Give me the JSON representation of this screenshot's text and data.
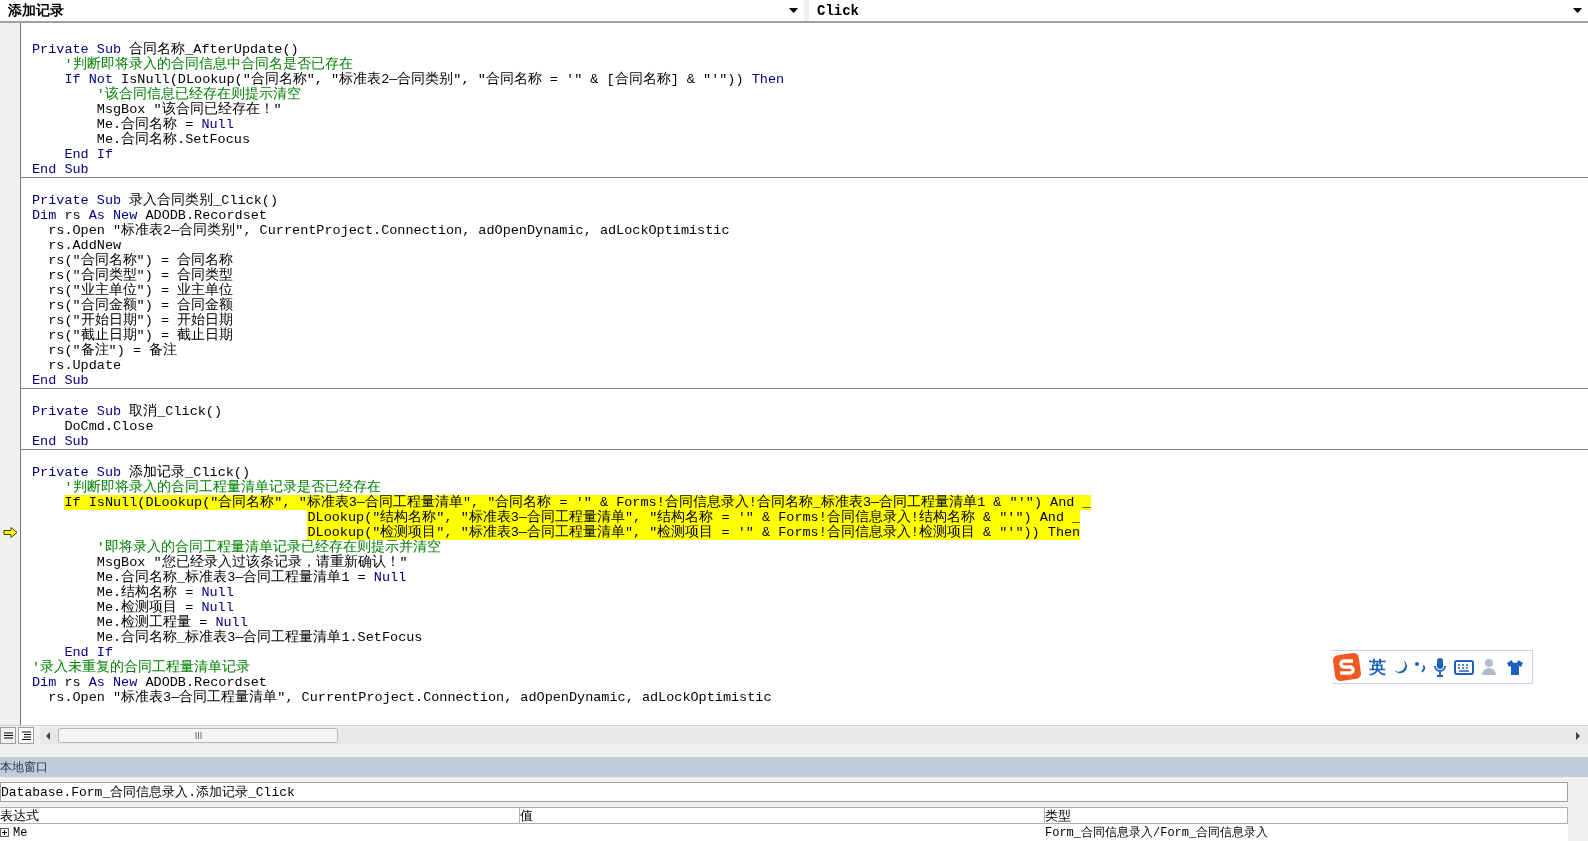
{
  "header": {
    "object_dropdown": "添加记录",
    "procedure_dropdown": "Click"
  },
  "procedures": [
    {
      "lines": [
        {
          "parts": [
            {
              "kind": "keyword",
              "text": "Private Sub"
            },
            {
              "kind": "plain",
              "text": " 合同名称_AfterUpdate()"
            }
          ]
        },
        {
          "parts": [
            {
              "kind": "comment",
              "text": "    '判断即将录入的合同信息中合同名是否已存在"
            }
          ]
        },
        {
          "parts": [
            {
              "kind": "keyword",
              "text": "    If Not"
            },
            {
              "kind": "plain",
              "text": " IsNull(DLookup(\"合同名称\", \"标准表2—合同类别\", \"合同名称 = '\" & [合同名称] & \"'\")) "
            },
            {
              "kind": "keyword",
              "text": "Then"
            }
          ]
        },
        {
          "parts": [
            {
              "kind": "comment",
              "text": "        '该合同信息已经存在则提示清空"
            }
          ]
        },
        {
          "parts": [
            {
              "kind": "plain",
              "text": "        MsgBox \"该合同已经存在！\""
            }
          ]
        },
        {
          "parts": [
            {
              "kind": "plain",
              "text": "        Me.合同名称 = "
            },
            {
              "kind": "keyword",
              "text": "Null"
            }
          ]
        },
        {
          "parts": [
            {
              "kind": "plain",
              "text": "        Me.合同名称.SetFocus"
            }
          ]
        },
        {
          "parts": [
            {
              "kind": "keyword",
              "text": "    End If"
            }
          ]
        },
        {
          "parts": [
            {
              "kind": "keyword",
              "text": "End Sub"
            }
          ]
        }
      ]
    },
    {
      "lines": [
        {
          "parts": [
            {
              "kind": "keyword",
              "text": "Private Sub"
            },
            {
              "kind": "plain",
              "text": " 录入合同类别_Click()"
            }
          ]
        },
        {
          "parts": [
            {
              "kind": "keyword",
              "text": "Dim"
            },
            {
              "kind": "plain",
              "text": " rs "
            },
            {
              "kind": "keyword",
              "text": "As New"
            },
            {
              "kind": "plain",
              "text": " ADODB.Recordset"
            }
          ]
        },
        {
          "parts": [
            {
              "kind": "plain",
              "text": "  rs.Open \"标准表2—合同类别\", CurrentProject.Connection, adOpenDynamic, adLockOptimistic"
            }
          ]
        },
        {
          "parts": [
            {
              "kind": "plain",
              "text": "  rs.AddNew"
            }
          ]
        },
        {
          "parts": [
            {
              "kind": "plain",
              "text": "  rs(\"合同名称\") = 合同名称"
            }
          ]
        },
        {
          "parts": [
            {
              "kind": "plain",
              "text": "  rs(\"合同类型\") = 合同类型"
            }
          ]
        },
        {
          "parts": [
            {
              "kind": "plain",
              "text": "  rs(\"业主单位\") = 业主单位"
            }
          ]
        },
        {
          "parts": [
            {
              "kind": "plain",
              "text": "  rs(\"合同金额\") = 合同金额"
            }
          ]
        },
        {
          "parts": [
            {
              "kind": "plain",
              "text": "  rs(\"开始日期\") = 开始日期"
            }
          ]
        },
        {
          "parts": [
            {
              "kind": "plain",
              "text": "  rs(\"截止日期\") = 截止日期"
            }
          ]
        },
        {
          "parts": [
            {
              "kind": "plain",
              "text": "  rs(\"备注\") = 备注"
            }
          ]
        },
        {
          "parts": [
            {
              "kind": "plain",
              "text": "  rs.Update"
            }
          ]
        },
        {
          "parts": [
            {
              "kind": "keyword",
              "text": "End Sub"
            }
          ]
        }
      ]
    },
    {
      "lines": [
        {
          "parts": [
            {
              "kind": "keyword",
              "text": "Private Sub"
            },
            {
              "kind": "plain",
              "text": " 取消_Click()"
            }
          ]
        },
        {
          "parts": [
            {
              "kind": "plain",
              "text": "    DoCmd.Close"
            }
          ]
        },
        {
          "parts": [
            {
              "kind": "keyword",
              "text": "End Sub"
            }
          ]
        }
      ]
    },
    {
      "lines": [
        {
          "parts": [
            {
              "kind": "keyword",
              "text": "Private Sub"
            },
            {
              "kind": "plain",
              "text": " 添加记录_Click()"
            }
          ]
        },
        {
          "parts": [
            {
              "kind": "comment",
              "text": "    '判断即将录入的合同工程量清单记录是否已经存在"
            }
          ]
        },
        {
          "highlighted": true,
          "parts": [
            {
              "kind": "plain",
              "text": "    If IsNull(DLookup(\"合同名称\", \"标准表3—合同工程量清单\", \"合同名称 = '\" & Forms!合同信息录入!合同名称_标准表3—合同工程量清单1 & \"'\") And _"
            }
          ]
        },
        {
          "highlighted": true,
          "parts": [
            {
              "kind": "plain",
              "text": "                                  DLookup(\"结构名称\", \"标准表3—合同工程量清单\", \"结构名称 = '\" & Forms!合同信息录入!结构名称 & \"'\") And _"
            }
          ]
        },
        {
          "highlighted": true,
          "current": true,
          "parts": [
            {
              "kind": "plain",
              "text": "                                  DLookup(\"检测项目\", \"标准表3—合同工程量清单\", \"检测项目 = '\" & Forms!合同信息录入!检测项目 & \"'\")) Then"
            }
          ]
        },
        {
          "parts": [
            {
              "kind": "comment",
              "text": "        '即将录入的合同工程量清单记录已经存在则提示并清空"
            }
          ]
        },
        {
          "parts": [
            {
              "kind": "plain",
              "text": "        MsgBox \"您已经录入过该条记录，请重新确认！\""
            }
          ]
        },
        {
          "parts": [
            {
              "kind": "plain",
              "text": "        Me.合同名称_标准表3—合同工程量清单1 = "
            },
            {
              "kind": "keyword",
              "text": "Null"
            }
          ]
        },
        {
          "parts": [
            {
              "kind": "plain",
              "text": "        Me.结构名称 = "
            },
            {
              "kind": "keyword",
              "text": "Null"
            }
          ]
        },
        {
          "parts": [
            {
              "kind": "plain",
              "text": "        Me.检测项目 = "
            },
            {
              "kind": "keyword",
              "text": "Null"
            }
          ]
        },
        {
          "parts": [
            {
              "kind": "plain",
              "text": "        Me.检测工程量 = "
            },
            {
              "kind": "keyword",
              "text": "Null"
            }
          ]
        },
        {
          "parts": [
            {
              "kind": "plain",
              "text": "        Me.合同名称_标准表3—合同工程量清单1.SetFocus"
            }
          ]
        },
        {
          "parts": [
            {
              "kind": "keyword",
              "text": "    End If"
            }
          ]
        },
        {
          "parts": [
            {
              "kind": "comment",
              "text": "'录入未重复的合同工程量清单记录"
            }
          ]
        },
        {
          "parts": [
            {
              "kind": "keyword",
              "text": "Dim"
            },
            {
              "kind": "plain",
              "text": " rs "
            },
            {
              "kind": "keyword",
              "text": "As New"
            },
            {
              "kind": "plain",
              "text": " ADODB.Recordset"
            }
          ]
        },
        {
          "parts": [
            {
              "kind": "plain",
              "text": "  rs.Open \"标准表3—合同工程量清单\", CurrentProject.Connection, adOpenDynamic, adLockOptimistic"
            }
          ]
        }
      ]
    }
  ],
  "ime_toolbar": {
    "mode": "英"
  },
  "locals": {
    "title": "本地窗口",
    "context": "Database.Form_合同信息录入.添加记录_Click",
    "columns": [
      "表达式",
      "值",
      "类型"
    ],
    "rows": [
      {
        "expression": "Me",
        "value": "",
        "type": "Form_合同信息录入/Form_合同信息录入",
        "expanded": false
      }
    ]
  }
}
